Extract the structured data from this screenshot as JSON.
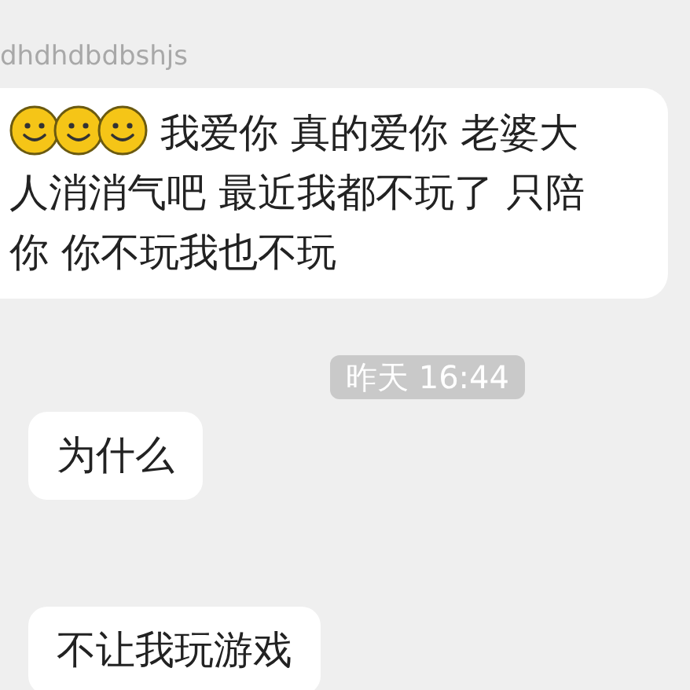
{
  "items": [
    {
      "kind": "message",
      "sender": "dhdhdbdbshjs",
      "leading_emoji": true,
      "text": "我爱你 真的爱你 老婆大人消消气吧 最近我都不玩了 只陪你 你不玩我也不玩"
    },
    {
      "kind": "timestamp",
      "text": "昨天 16:44"
    },
    {
      "kind": "message",
      "leading_emoji": false,
      "text": "为什么"
    },
    {
      "kind": "message",
      "leading_emoji": false,
      "text": "不让我玩游戏"
    }
  ]
}
